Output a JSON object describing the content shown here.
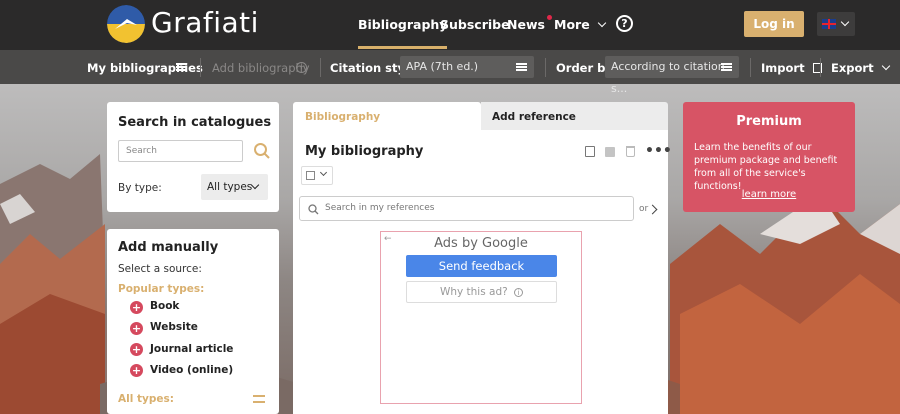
{
  "header": {
    "logo_text": "Grafiati",
    "nav": [
      "Bibliography",
      "Subscribe",
      "News",
      "More"
    ],
    "help_glyph": "?",
    "login": "Log in",
    "language_icon": "uk-flag-icon"
  },
  "toolbar": {
    "my_bibliographies": "My bibliographies",
    "add_bibliography": "Add bibliography",
    "citation_style_label": "Citation style:",
    "citation_style_value": "APA (7th ed.)",
    "order_by_label": "Order by:",
    "order_by_value": "According to citation s...",
    "import": "Import",
    "export": "Export"
  },
  "search_catalogues": {
    "title": "Search in catalogues",
    "search_placeholder": "Search",
    "by_type_label": "By type:",
    "type_value": "All types"
  },
  "add_manually": {
    "title": "Add manually",
    "select_source": "Select a source:",
    "popular_types_label": "Popular types:",
    "sources": [
      "Book",
      "Website",
      "Journal article",
      "Video (online)"
    ],
    "all_types_label": "All types:"
  },
  "bibliography": {
    "tabs": [
      "Bibliography",
      "Add reference"
    ],
    "title": "My bibliography",
    "search_placeholder": "Search in my references",
    "or_label": "or"
  },
  "ad": {
    "ads_by": "Ads by Google",
    "send_feedback": "Send feedback",
    "why_this_ad": "Why this ad?"
  },
  "premium": {
    "title": "Premium",
    "text": "Learn the benefits of our premium package and benefit from all of the service's functions!",
    "link": "learn more"
  },
  "colors": {
    "accent": "#d9b06f",
    "premium": "#d75465",
    "topbar": "#2b2a2a",
    "toolbar": "#4a4948",
    "feedback_button": "#4a86e8"
  }
}
